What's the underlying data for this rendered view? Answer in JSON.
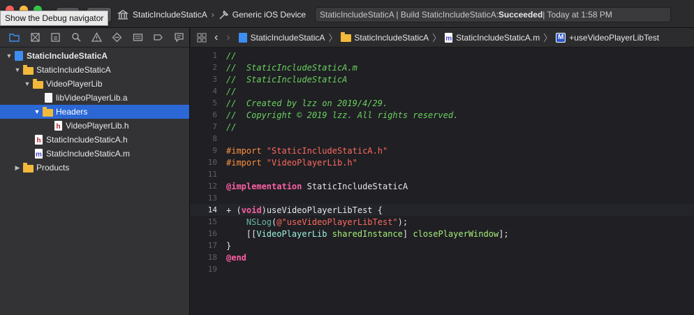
{
  "tooltip": "Show the Debug navigator",
  "toolbar": {
    "scheme": "StaticIncludeStaticA",
    "device": "Generic iOS Device",
    "status_prefix": "StaticIncludeStaticA | Build StaticIncludeStaticA: ",
    "status_result": "Succeeded",
    "status_time": " | Today at 1:58 PM"
  },
  "navigator": {
    "tabs": [
      "folder-icon",
      "source-control-icon",
      "symbol-icon",
      "find-icon",
      "issue-icon",
      "test-icon",
      "debug-icon",
      "breakpoint-icon",
      "report-icon"
    ],
    "items": [
      {
        "label": "StaticIncludeStaticA"
      },
      {
        "label": "StaticIncludeStaticA"
      },
      {
        "label": "VideoPlayerLib"
      },
      {
        "label": "libVideoPlayerLib.a"
      },
      {
        "label": "Headers"
      },
      {
        "label": "VideoPlayerLib.h"
      },
      {
        "label": "StaticIncludeStaticA.h"
      },
      {
        "label": "StaticIncludeStaticA.m"
      },
      {
        "label": "Products"
      }
    ]
  },
  "jumpbar": {
    "crumbs": [
      "StaticIncludeStaticA",
      "StaticIncludeStaticA",
      "StaticIncludeStaticA.m",
      "+useVideoPlayerLibTest"
    ]
  },
  "editor": {
    "current_line": 14,
    "lines": [
      {
        "n": "1",
        "t": "//"
      },
      {
        "n": "2",
        "t": "//  StaticIncludeStaticA.m"
      },
      {
        "n": "3",
        "t": "//  StaticIncludeStaticA"
      },
      {
        "n": "4",
        "t": "//"
      },
      {
        "n": "5",
        "t": "//  Created by lzz on 2019/4/29."
      },
      {
        "n": "6",
        "t": "//  Copyright © 2019 lzz. All rights reserved."
      },
      {
        "n": "7",
        "t": "//"
      },
      {
        "n": "8",
        "t": ""
      },
      {
        "n": "9",
        "t": "#import \"StaticIncludeStaticA.h\""
      },
      {
        "n": "10",
        "t": "#import \"VideoPlayerLib.h\""
      },
      {
        "n": "11",
        "t": ""
      },
      {
        "n": "12",
        "t": "@implementation StaticIncludeStaticA"
      },
      {
        "n": "13",
        "t": ""
      },
      {
        "n": "14",
        "t": "+ (void)useVideoPlayerLibTest {"
      },
      {
        "n": "15",
        "t": "    NSLog(@\"useVideoPlayerLibTest\");"
      },
      {
        "n": "16",
        "t": "    [[VideoPlayerLib sharedInstance] closePlayerWindow];"
      },
      {
        "n": "17",
        "t": "}"
      },
      {
        "n": "18",
        "t": "@end"
      },
      {
        "n": "19",
        "t": ""
      }
    ]
  },
  "colors": {
    "selection": "#2b68d6",
    "comment": "#6bd15d",
    "preprocessor": "#fd8f3f",
    "string": "#fc6a5d",
    "keyword": "#fc5fa3",
    "folder": "#f2b93b"
  }
}
